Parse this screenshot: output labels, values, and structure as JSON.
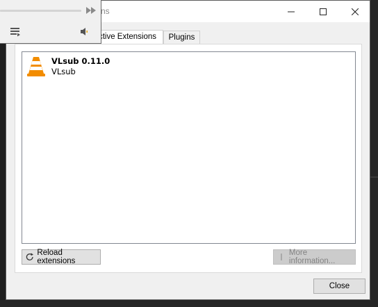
{
  "window": {
    "title": "ns",
    "controls": {
      "minimize": "minimize-icon",
      "maximize": "maximize-icon",
      "close": "close-icon"
    }
  },
  "tabs": [
    {
      "label": "Active Extensions",
      "shown": "ctive Extensions",
      "active": true
    },
    {
      "label": "Plugins",
      "active": false
    }
  ],
  "extensions": [
    {
      "name": "VLsub 0.11.0",
      "subtitle": "VLsub",
      "icon": "vlc-cone-icon"
    }
  ],
  "buttons": {
    "reload": "Reload extensions",
    "more_info": "More information...",
    "close": "Close"
  },
  "player": {
    "icons": [
      "fast-forward-icon",
      "playlist-icon",
      "volume-icon"
    ]
  },
  "colors": {
    "cone_orange": "#f28c00",
    "cone_white": "#ffffff",
    "disabled_text": "#838383"
  }
}
